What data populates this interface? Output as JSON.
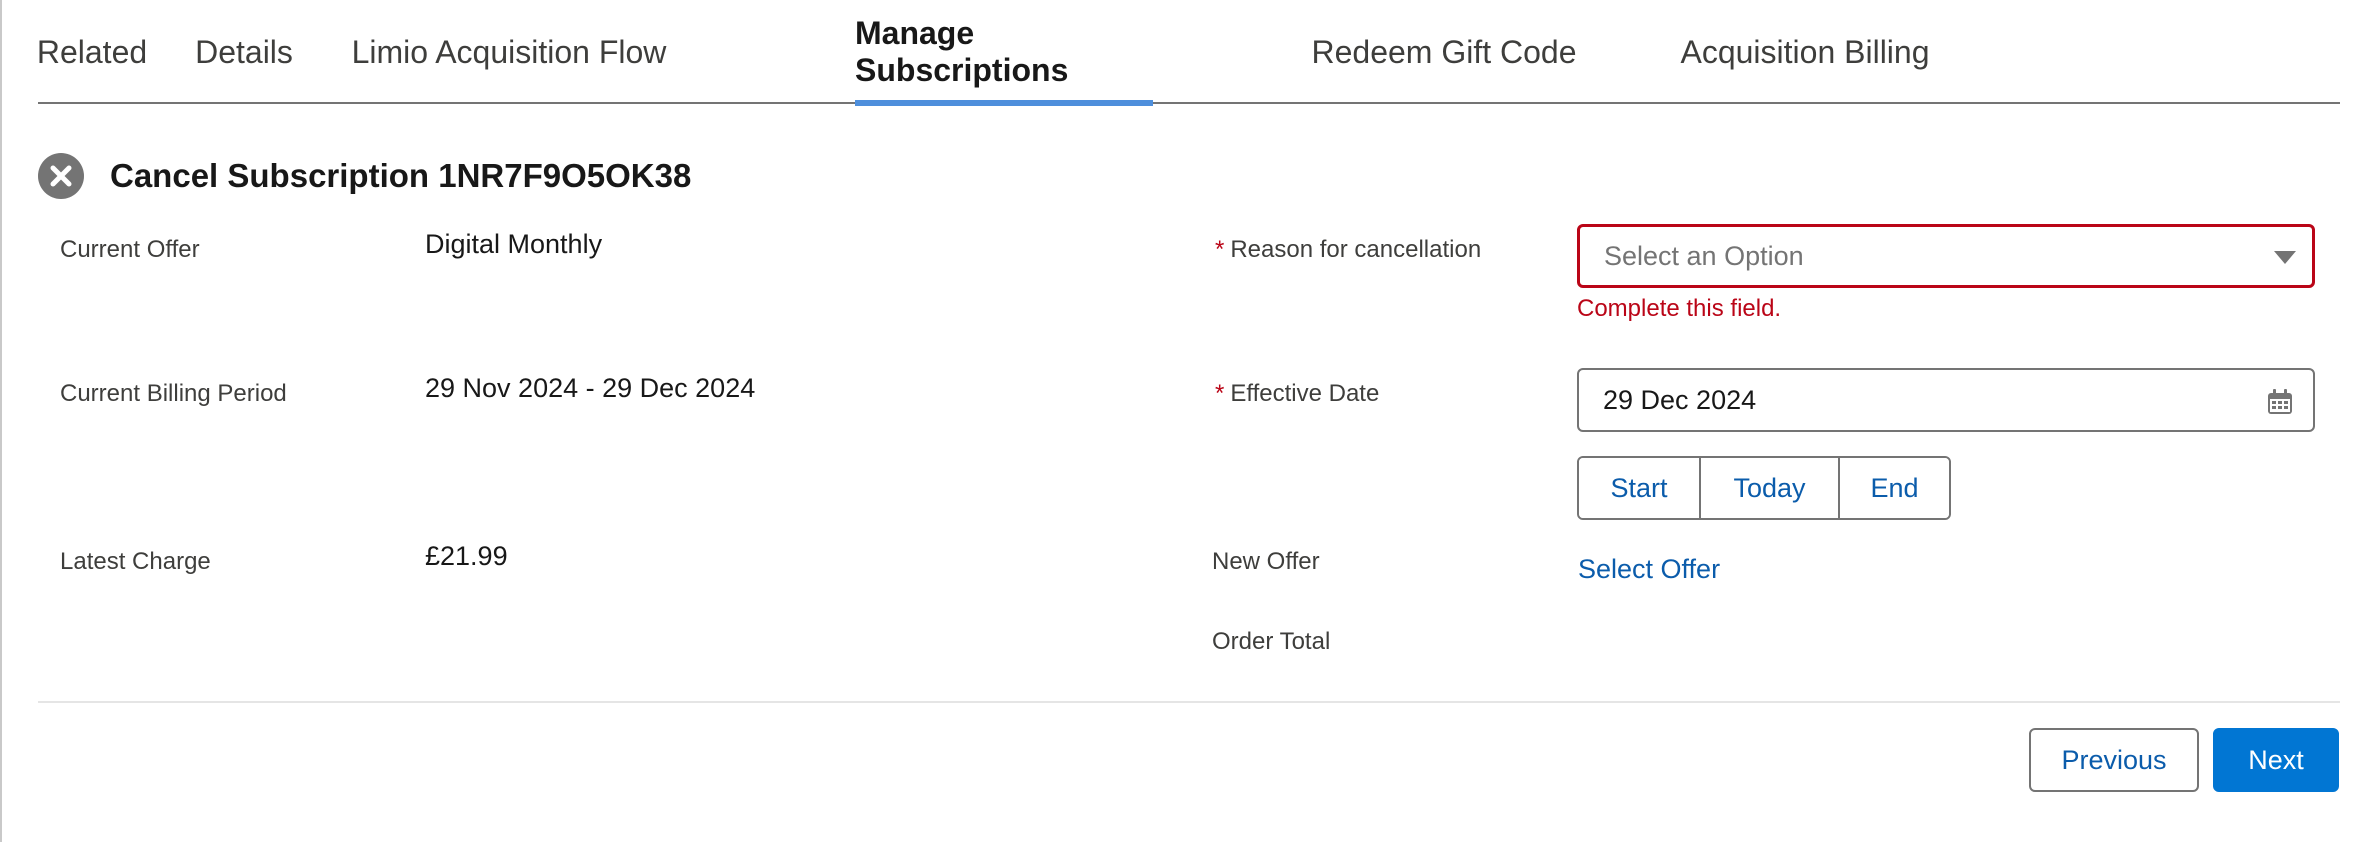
{
  "tabs": [
    {
      "label": "Related"
    },
    {
      "label": "Details"
    },
    {
      "label": "Limio Acquisition Flow"
    },
    {
      "label": "Manage Subscriptions",
      "active": true
    },
    {
      "label": "Redeem Gift Code"
    },
    {
      "label": "Acquisition Billing"
    }
  ],
  "header": {
    "icon": "close-circle-icon",
    "title": "Cancel Subscription 1NR7F9O5OK38"
  },
  "left_fields": {
    "current_offer": {
      "label": "Current Offer",
      "value": "Digital Monthly"
    },
    "billing_period": {
      "label": "Current Billing Period",
      "value": "29 Nov 2024 - 29 Dec 2024"
    },
    "latest_charge": {
      "label": "Latest Charge",
      "value": "£21.99"
    }
  },
  "right_fields": {
    "required_marker": "*",
    "reason": {
      "label": "Reason for cancellation",
      "placeholder": "Select an Option",
      "error": "Complete this field."
    },
    "effective_date": {
      "label": "Effective Date",
      "value": "29 Dec 2024",
      "buttons": {
        "start": "Start",
        "today": "Today",
        "end": "End"
      }
    },
    "new_offer": {
      "label": "New Offer",
      "link": "Select Offer"
    },
    "order_total": {
      "label": "Order Total"
    }
  },
  "footer": {
    "previous_label": "Previous",
    "next_label": "Next"
  },
  "colors": {
    "accent": "#0176d3",
    "link": "#0b5cab",
    "error": "#ba0517",
    "tab_indicator": "#4e8fdc"
  }
}
